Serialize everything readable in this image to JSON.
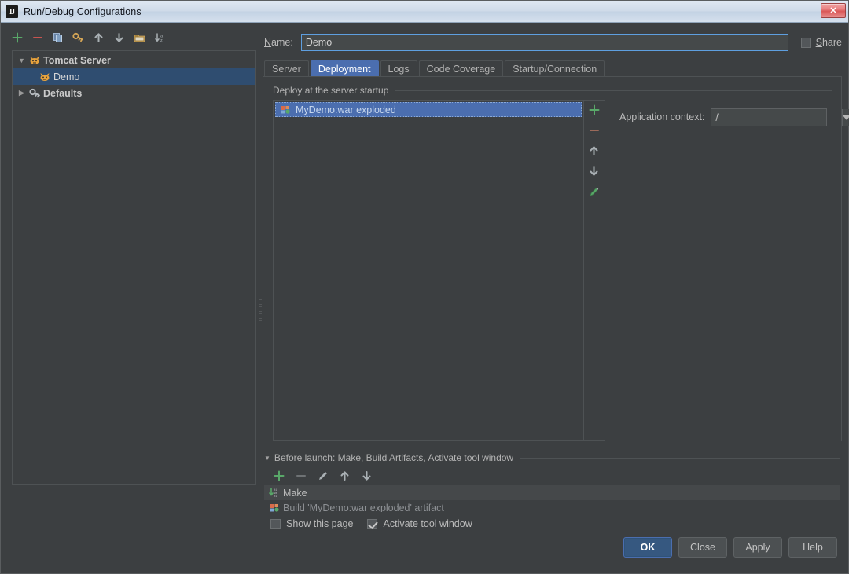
{
  "window": {
    "title": "Run/Debug Configurations",
    "app_icon": "IJ",
    "close_icon": "close-icon",
    "close_glyph": "✕"
  },
  "left_toolbar": {
    "items": [
      {
        "name": "add-configuration-button",
        "icon": "plus-icon",
        "tooltip": "Add New Configuration"
      },
      {
        "name": "remove-configuration-button",
        "icon": "minus-icon",
        "tooltip": "Remove Configuration"
      },
      {
        "name": "copy-configuration-button",
        "icon": "copy-icon",
        "tooltip": "Copy Configuration"
      },
      {
        "name": "save-configuration-button",
        "icon": "wrench-key-icon",
        "tooltip": "Save Configuration"
      },
      {
        "name": "move-up-button",
        "icon": "arrow-up-icon",
        "tooltip": "Move Up"
      },
      {
        "name": "move-down-button",
        "icon": "arrow-down-icon",
        "tooltip": "Move Down"
      },
      {
        "name": "create-folder-button",
        "icon": "folder-icon",
        "tooltip": "Create New Folder"
      },
      {
        "name": "sort-configurations-button",
        "icon": "sort-az-icon",
        "tooltip": "Sort Configurations"
      }
    ]
  },
  "tree": {
    "nodes": [
      {
        "label": "Tomcat Server",
        "icon": "tomcat-icon",
        "expanded": true,
        "bold": true,
        "level": 0,
        "selected": false,
        "twisty": "▼"
      },
      {
        "label": "Demo",
        "icon": "tomcat-icon",
        "level": 1,
        "selected": true,
        "bold": false,
        "twisty": ""
      },
      {
        "label": "Defaults",
        "icon": "wrench-key-icon",
        "expanded": false,
        "bold": true,
        "level": 0,
        "selected": false,
        "twisty": "▶"
      }
    ]
  },
  "name_field": {
    "label": "Name:",
    "label_mnemonic": "N",
    "label_rest": "ame:",
    "value": "Demo",
    "placeholder": ""
  },
  "share": {
    "label": "Share",
    "label_mnemonic": "S",
    "label_rest": "hare",
    "checked": false
  },
  "tabs": [
    {
      "label": "Server",
      "active": false,
      "name": "tab-server"
    },
    {
      "label": "Deployment",
      "active": true,
      "name": "tab-deployment"
    },
    {
      "label": "Logs",
      "active": false,
      "name": "tab-logs"
    },
    {
      "label": "Code Coverage",
      "active": false,
      "name": "tab-code-coverage"
    },
    {
      "label": "Startup/Connection",
      "active": false,
      "name": "tab-startup-connection"
    }
  ],
  "deployment": {
    "group_title": "Deploy at the server startup",
    "artifacts": [
      {
        "label": "MyDemo:war exploded",
        "icon": "artifact-icon",
        "selected": true
      }
    ],
    "side_toolbar": [
      {
        "name": "add-artifact-button",
        "icon": "plus-icon"
      },
      {
        "name": "remove-artifact-button",
        "icon": "minus-icon"
      },
      {
        "name": "artifact-move-up-button",
        "icon": "arrow-up-icon"
      },
      {
        "name": "artifact-move-down-button",
        "icon": "arrow-down-icon"
      },
      {
        "name": "edit-artifact-button",
        "icon": "pencil-icon"
      }
    ],
    "application_context": {
      "label": "Application context:",
      "value": "/",
      "dropdown_icon": "chevron-down-icon"
    }
  },
  "before_launch": {
    "title": "Before launch: Make, Build Artifacts, Activate tool window",
    "title_mnemonic": "B",
    "title_rest": "efore launch: Make, Build Artifacts, Activate tool window",
    "expanded": true,
    "triangle": "▼",
    "toolbar": [
      {
        "name": "add-task-button",
        "icon": "plus-icon"
      },
      {
        "name": "remove-task-button",
        "icon": "minus-icon"
      },
      {
        "name": "edit-task-button",
        "icon": "pencil-icon"
      },
      {
        "name": "task-move-up-button",
        "icon": "arrow-up-icon"
      },
      {
        "name": "task-move-down-button",
        "icon": "arrow-down-icon"
      }
    ],
    "tasks": [
      {
        "label": "Make",
        "icon": "make-icon"
      },
      {
        "label": "Build 'MyDemo:war exploded' artifact",
        "icon": "artifact-icon"
      }
    ],
    "checkboxes": [
      {
        "label": "Show this page",
        "checked": false,
        "name": "show-this-page-checkbox"
      },
      {
        "label": "Activate tool window",
        "checked": true,
        "name": "activate-tool-window-checkbox"
      }
    ]
  },
  "footer_buttons": [
    {
      "label": "OK",
      "primary": true,
      "name": "ok-button"
    },
    {
      "label": "Close",
      "primary": false,
      "name": "close-button"
    },
    {
      "label": "Apply",
      "primary": false,
      "name": "apply-button"
    },
    {
      "label": "Help",
      "primary": false,
      "name": "help-button"
    }
  ],
  "colors": {
    "window_bg": "#3c3f41",
    "titlebar_gradient_top": "#dfe8f2",
    "titlebar_gradient_bottom": "#c3d2e4",
    "accent_blue": "#4b6eaf",
    "tree_selection": "#2f4d70",
    "primary_button": "#365880",
    "text": "#bbbbbb",
    "field_bg": "#45494a",
    "border": "#4e5254",
    "green_icon": "#59a869",
    "red_icon": "#c75450",
    "focus_border": "#5e9fe0"
  }
}
